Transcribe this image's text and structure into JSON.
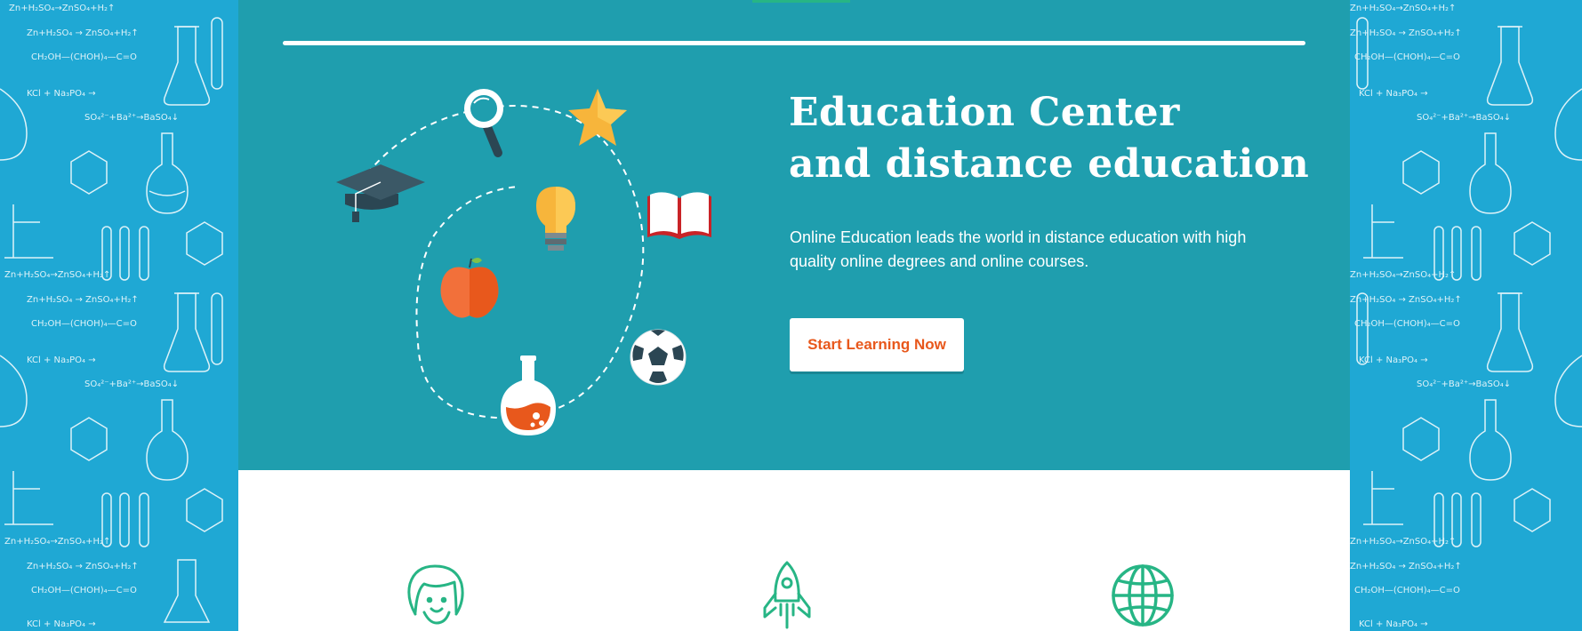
{
  "hero": {
    "title_line1": "Education Center",
    "title_line2": "and distance education",
    "description": "Online Education leads the world in distance education with high quality online degrees and online courses.",
    "cta_label": "Start Learning Now"
  },
  "illustration_icons": [
    "graduation-cap-icon",
    "magnifier-icon",
    "star-icon",
    "lightbulb-icon",
    "book-icon",
    "apple-icon",
    "flask-icon",
    "soccer-ball-icon"
  ],
  "feature_icons": [
    "girl-face-icon",
    "rocket-icon",
    "globe-icon"
  ],
  "side_doodles": {
    "formula_1": "Zn + H2SO4 → ZnSO4 + H2↑",
    "formula_2": "KCl + Na3PO4 →",
    "formula_3": "CH2OH — (CHOH)4 — C=O"
  },
  "colors": {
    "side_background": "#1fa8d4",
    "hero_background": "#1f9eae",
    "accent_green": "#27b585",
    "cta_text": "#e8581c",
    "white": "#ffffff"
  }
}
